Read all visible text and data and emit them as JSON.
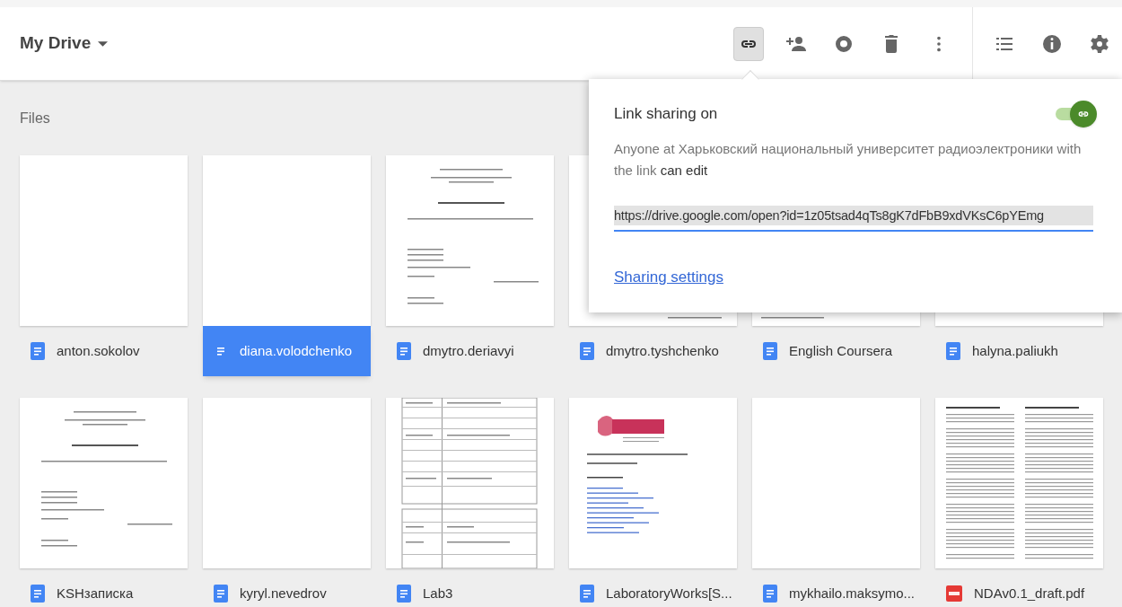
{
  "header": {
    "title": "My Drive",
    "actions": [
      {
        "selected": true
      },
      {
        "selected": false
      },
      {
        "selected": false
      },
      {
        "selected": false
      },
      {
        "selected": false
      }
    ]
  },
  "section_title": "Files",
  "files": [
    {
      "name": "anton.sokolov",
      "kind": "doc",
      "selected": false
    },
    {
      "name": "diana.volodchenko",
      "kind": "doc",
      "selected": true
    },
    {
      "name": "dmytro.deriavyi",
      "kind": "doc",
      "selected": false
    },
    {
      "name": "dmytro.tyshchenko",
      "kind": "doc",
      "selected": false
    },
    {
      "name": "English Coursera",
      "kind": "doc",
      "selected": false
    },
    {
      "name": "halyna.paliukh",
      "kind": "doc",
      "selected": false
    },
    {
      "name": "KSHзаписка",
      "kind": "doc",
      "selected": false
    },
    {
      "name": "kyryl.nevedrov",
      "kind": "doc",
      "selected": false
    },
    {
      "name": "Lab3",
      "kind": "doc",
      "selected": false
    },
    {
      "name": "LaboratoryWorks[S...",
      "kind": "doc",
      "selected": false
    },
    {
      "name": "mykhailo.maksymo...",
      "kind": "doc",
      "selected": false
    },
    {
      "name": "NDAv0.1_draft.pdf",
      "kind": "pdf",
      "selected": false
    }
  ],
  "share_popup": {
    "title": "Link sharing on",
    "on": true,
    "description": "Anyone at Харьковский национальный университет радиоэлектроники with the link",
    "access": "can edit",
    "link": "https://drive.google.com/open?id=1z05tsad4qTs8gK7dFbB9xdVKsC6pYEmg",
    "settings_link": "Sharing settings"
  }
}
